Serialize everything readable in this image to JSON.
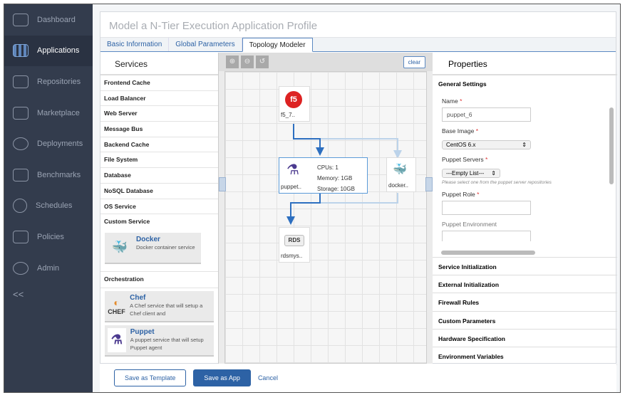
{
  "sidebar": {
    "items": [
      {
        "label": "Dashboard",
        "icon": "dashboard-icon"
      },
      {
        "label": "Applications",
        "icon": "applications-icon"
      },
      {
        "label": "Repositories",
        "icon": "repositories-icon"
      },
      {
        "label": "Marketplace",
        "icon": "cart-icon"
      },
      {
        "label": "Deployments",
        "icon": "cloud-icon"
      },
      {
        "label": "Benchmarks",
        "icon": "bar-chart-icon"
      },
      {
        "label": "Schedules",
        "icon": "clock-icon"
      },
      {
        "label": "Policies",
        "icon": "gavel-icon"
      },
      {
        "label": "Admin",
        "icon": "gears-icon"
      }
    ],
    "collapse": "<<"
  },
  "page": {
    "title": "Model a N-Tier Execution Application Profile"
  },
  "tabs": [
    "Basic Information",
    "Global Parameters",
    "Topology Modeler"
  ],
  "services": {
    "title": "Services",
    "categories": [
      "Frontend Cache",
      "Load Balancer",
      "Web Server",
      "Message Bus",
      "Backend Cache",
      "File System",
      "Database",
      "NoSQL Database",
      "OS Service",
      "Custom Service"
    ],
    "custom": {
      "name": "Docker",
      "desc": "Docker container service"
    },
    "orchestration": "Orchestration",
    "orch_items": [
      {
        "name": "Chef",
        "desc": "A Chef service that will setup a Chef client and",
        "logo": "CHEF"
      },
      {
        "name": "Puppet",
        "desc": "A puppet service that will setup Puppet agent"
      }
    ]
  },
  "canvas": {
    "clear": "clear",
    "nodes": {
      "f5": "f5_7..",
      "puppet": "puppet..",
      "docker": "docker..",
      "rds": "rdsmys..",
      "rds_logo": "RDS"
    },
    "puppet_info": {
      "cpus": "CPUs: 1",
      "memory": "Memory: 1GB",
      "storage": "Storage: 10GB"
    }
  },
  "properties": {
    "title": "Properties",
    "general": "General Settings",
    "name_label": "Name",
    "name_value": "puppet_6",
    "base_label": "Base Image",
    "base_value": "CentOS 6.x",
    "servers_label": "Puppet Servers",
    "servers_value": "---Empty List---",
    "servers_hint": "Please select one from the puppet server repositories",
    "role_label": "Puppet Role",
    "env_label": "Puppet Environment",
    "sections": [
      "Service Initialization",
      "External Initialization",
      "Firewall Rules",
      "Custom Parameters",
      "Hardware Specification",
      "Environment Variables"
    ]
  },
  "footer": {
    "template": "Save as Template",
    "app": "Save as App",
    "cancel": "Cancel"
  }
}
